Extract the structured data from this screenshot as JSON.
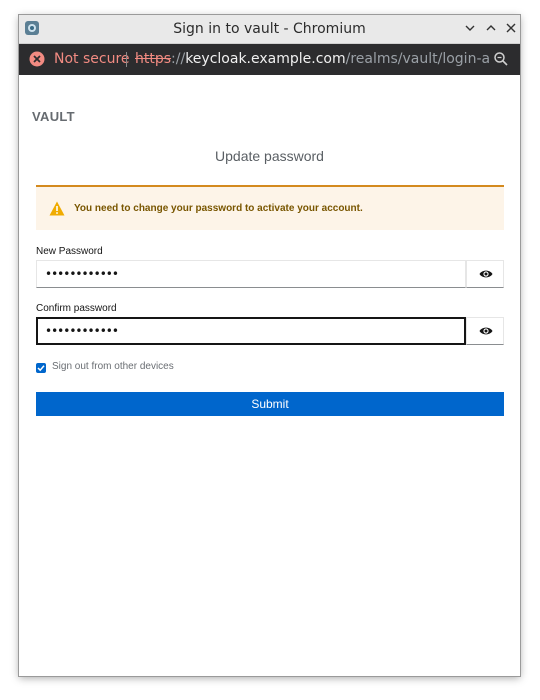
{
  "window": {
    "title": "Sign in to vault - Chromium"
  },
  "addressbar": {
    "security_label": "Not secure",
    "url_scheme": "https",
    "url_sep": "://",
    "url_host": "keycloak.example.com",
    "url_path": "/realms/vault/login-action..."
  },
  "page": {
    "realm_name": "VAULT",
    "title": "Update password",
    "alert_message": "You need to change your password to activate your account.",
    "new_password_label": "New Password",
    "new_password_value": "••••••••••••",
    "confirm_password_label": "Confirm password",
    "confirm_password_value": "••••••••••••",
    "sign_out_label": "Sign out from other devices",
    "sign_out_checked": true,
    "submit_label": "Submit"
  },
  "colors": {
    "primary": "#0066cc",
    "warning_border": "#d48a1e",
    "warning_bg": "#fdf4e8",
    "warning_text": "#795600",
    "not_secure": "#f28b82"
  }
}
